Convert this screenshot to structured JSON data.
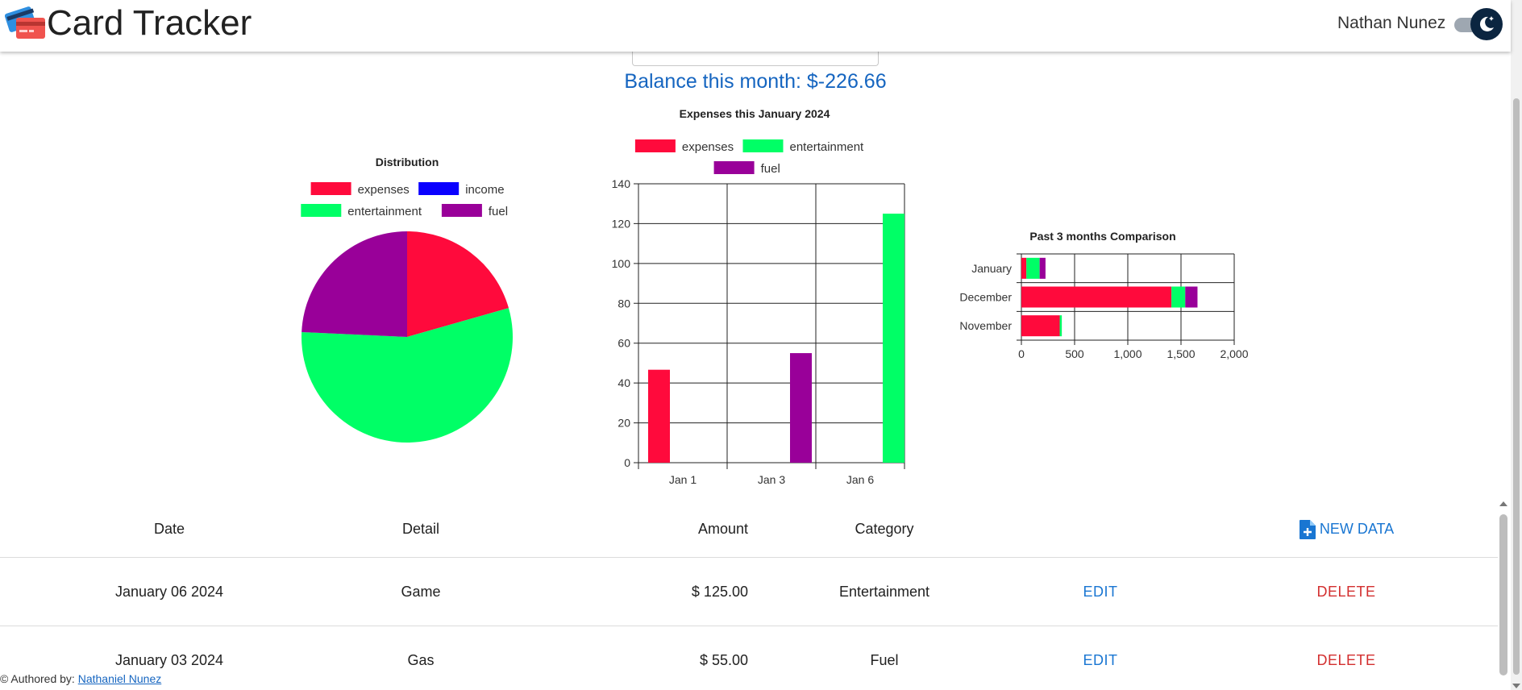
{
  "app": {
    "title": "Card Tracker",
    "user_name": "Nathan Nunez"
  },
  "balance_text": "Balance this month: $-226.66",
  "colors": {
    "expenses": "#ff0a3c",
    "income": "#0a00ff",
    "entertainment": "#00ff66",
    "fuel": "#990099",
    "accent": "#1565c0"
  },
  "chart_data": [
    {
      "type": "pie",
      "title": "Distribution",
      "legend": [
        "expenses",
        "income",
        "entertainment",
        "fuel"
      ],
      "slices": [
        {
          "label": "expenses",
          "value": 46.66
        },
        {
          "label": "income",
          "value": 0
        },
        {
          "label": "entertainment",
          "value": 125
        },
        {
          "label": "fuel",
          "value": 55
        }
      ],
      "legend_position": "top"
    },
    {
      "type": "bar",
      "title": "Expenses this January 2024",
      "categories": [
        "Jan 1",
        "Jan 3",
        "Jan 6"
      ],
      "series": [
        {
          "name": "expenses",
          "values": [
            46.66,
            0,
            0
          ]
        },
        {
          "name": "entertainment",
          "values": [
            0,
            0,
            125
          ]
        },
        {
          "name": "fuel",
          "values": [
            0,
            55,
            0
          ]
        }
      ],
      "ylim": [
        0,
        140
      ],
      "yticks": [
        "0",
        "20",
        "40",
        "60",
        "80",
        "100",
        "120",
        "140"
      ],
      "grid": true,
      "legend_position": "top"
    },
    {
      "type": "bar",
      "orientation": "horizontal",
      "stacked": true,
      "title": "Past 3 months Comparison",
      "categories": [
        "January",
        "December",
        "November"
      ],
      "series": [
        {
          "name": "expenses",
          "values": [
            46.66,
            1410,
            360
          ]
        },
        {
          "name": "entertainment",
          "values": [
            125,
            130,
            20
          ]
        },
        {
          "name": "fuel",
          "values": [
            55,
            115,
            0
          ]
        }
      ],
      "xlim": [
        0,
        2000
      ],
      "xticks": [
        "0",
        "500",
        "1,000",
        "1,500",
        "2,000"
      ],
      "grid": true
    }
  ],
  "table": {
    "headers": {
      "date": "Date",
      "detail": "Detail",
      "amount": "Amount",
      "category": "Category",
      "new_data": "NEW DATA"
    },
    "rows": [
      {
        "date": "January 06 2024",
        "detail": "Game",
        "amount": "$ 125.00",
        "category": "Entertainment",
        "edit": "EDIT",
        "delete": "DELETE"
      },
      {
        "date": "January 03 2024",
        "detail": "Gas",
        "amount": "$ 55.00",
        "category": "Fuel",
        "edit": "EDIT",
        "delete": "DELETE"
      }
    ]
  },
  "footer": {
    "prefix": "© Authored by:",
    "author_link": "Nathaniel Nunez"
  }
}
